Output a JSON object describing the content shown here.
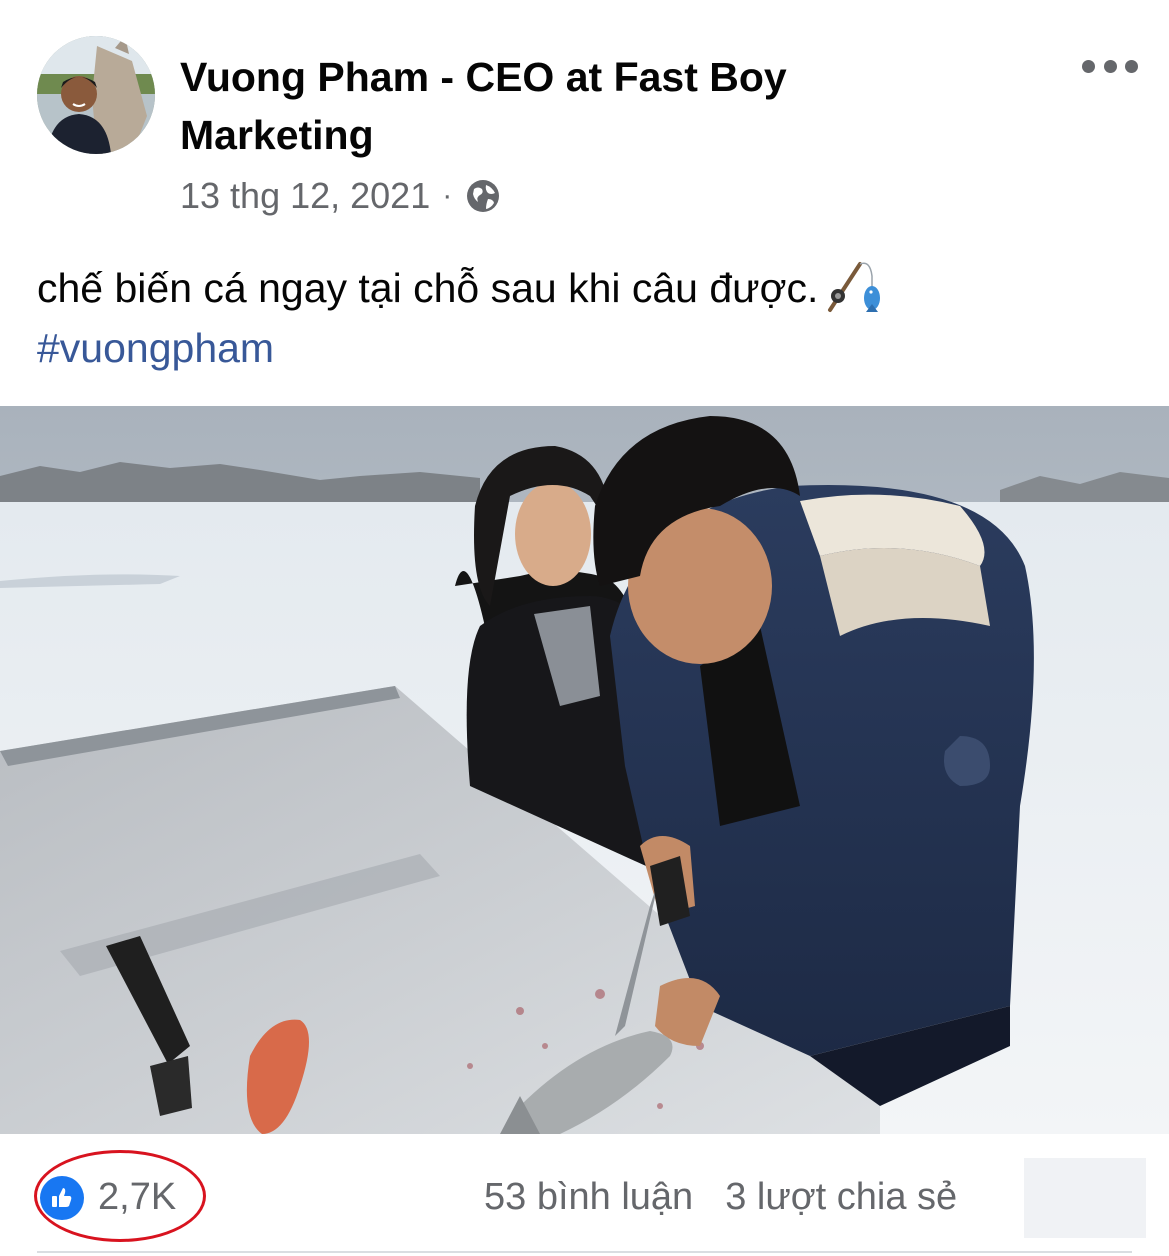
{
  "post": {
    "author_name": "Vuong Pham - CEO at Fast Boy Marketing",
    "timestamp": "13 thg 12, 2021",
    "separator": "·",
    "privacy_icon": "globe-icon",
    "more_icon": "more-options-icon",
    "caption_text": "chế biến cá ngay tại chỗ sau khi câu được.",
    "caption_emoji": "fishing-pole-icon",
    "hashtag": "#vuongpham"
  },
  "engagement": {
    "reaction_icon": "like-icon",
    "reaction_count": "2,7K",
    "comments": "53 bình luận",
    "shares": "3 lượt chia sẻ",
    "highlight_color": "#d8131f"
  },
  "colors": {
    "link": "#385898",
    "meta_text": "#65676b",
    "like_blue": "#1877f2"
  }
}
